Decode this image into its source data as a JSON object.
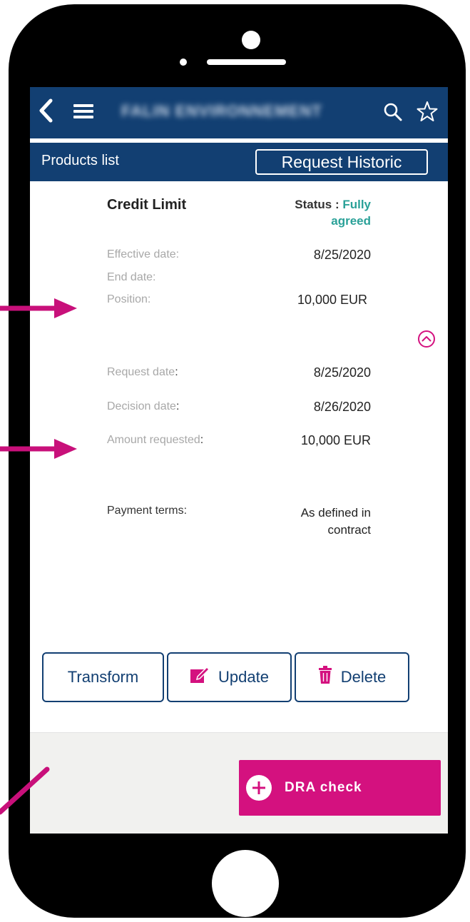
{
  "header": {
    "title": "FALIN ENVIRONNEMENT"
  },
  "subheader": {
    "title": "Products list",
    "historic_button": "Request Historic"
  },
  "card": {
    "title": "Credit Limit",
    "status_label": "Status : ",
    "status_value_line1": "Fully",
    "status_value_line2": "agreed",
    "status_color": "#2aa198",
    "fields": {
      "effective_date_label": "Effective date:",
      "effective_date_value": "8/25/2020",
      "end_date_label": "End date:",
      "position_label": "Position:",
      "position_value": "10,000 EUR",
      "request_date_label": "Request date",
      "request_date_value": "8/25/2020",
      "decision_date_label": "Decision date",
      "decision_date_value": "8/26/2020",
      "amount_requested_label": "Amount requested",
      "amount_requested_value": "10,000 EUR",
      "payment_terms_label": "Payment terms:",
      "payment_terms_value_line1": "As defined in",
      "payment_terms_value_line2": "contract"
    }
  },
  "actions": {
    "transform_label": "Transform",
    "update_label": "Update",
    "delete_label": "Delete"
  },
  "footer": {
    "dra_label": "DRA check"
  },
  "icons": {
    "back": "chevron-left-icon",
    "menu": "hamburger-menu-icon",
    "search": "search-icon",
    "favorite": "star-outline-icon",
    "collapse": "chevron-up-circle-icon",
    "edit": "edit-square-icon",
    "delete": "trash-icon",
    "add": "plus-circle-icon"
  },
  "colors": {
    "primary": "#123f72",
    "accent": "#d4117f",
    "status": "#2aa198",
    "annotation": "#c8107a"
  }
}
